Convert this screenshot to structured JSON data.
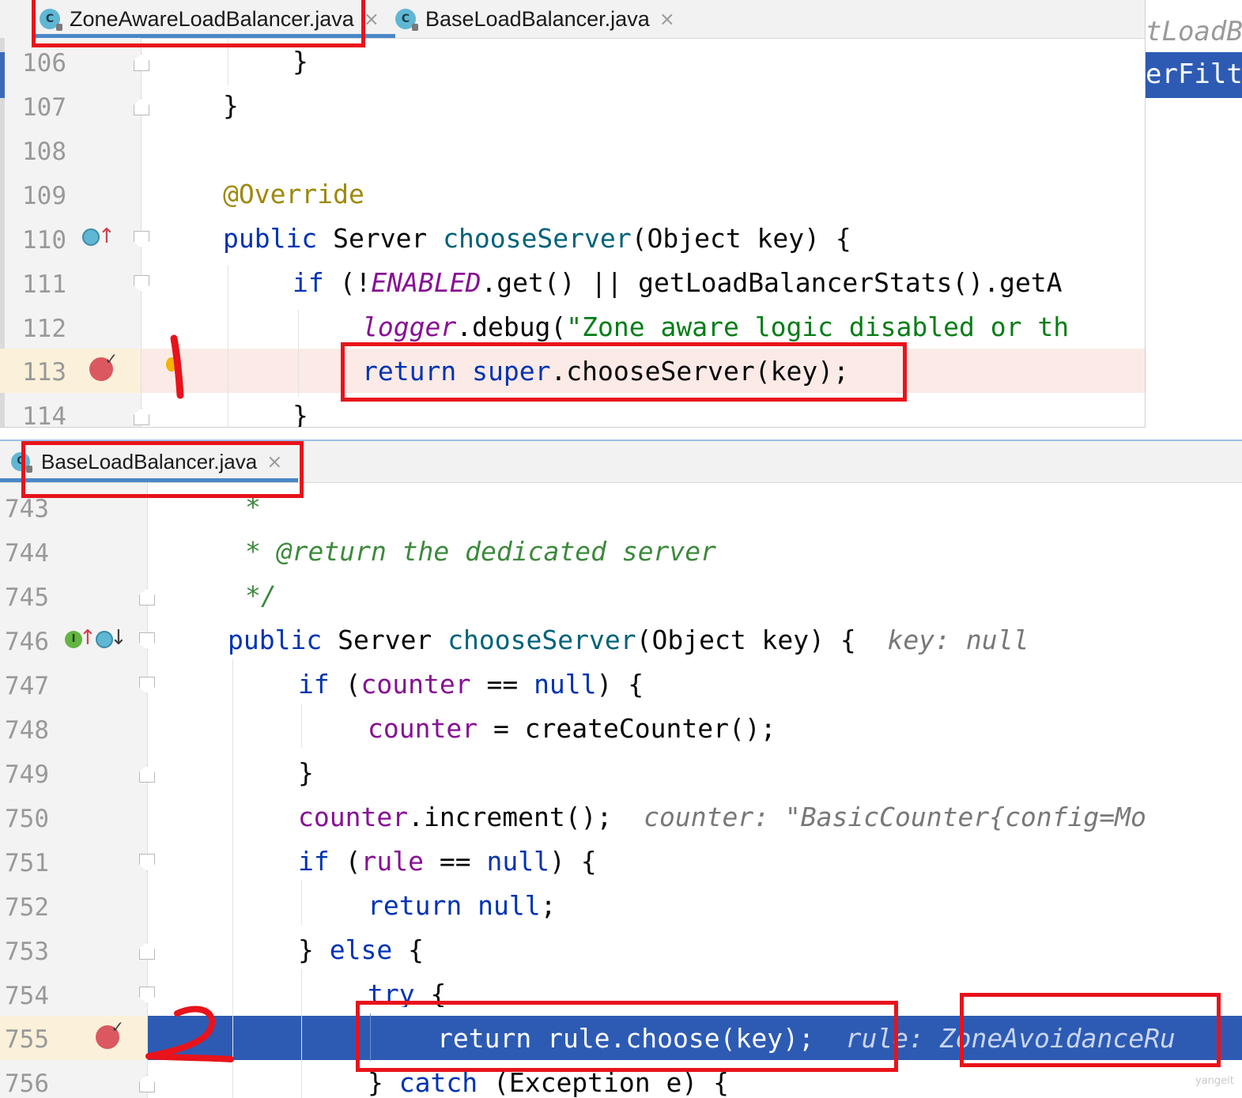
{
  "top_editor": {
    "tabs": [
      {
        "label": "ZoneAwareLoadBalancer.java",
        "close": "×",
        "active": true
      },
      {
        "label": "BaseLoadBalancer.java",
        "close": "×",
        "active": false
      }
    ],
    "right_peek": [
      "tLoadB",
      "erFilt"
    ],
    "lines": [
      {
        "num": "106"
      },
      {
        "num": "107"
      },
      {
        "num": "108"
      },
      {
        "num": "109"
      },
      {
        "num": "110"
      },
      {
        "num": "111"
      },
      {
        "num": "112"
      },
      {
        "num": "113"
      },
      {
        "num": "114"
      }
    ],
    "code": {
      "l106": "}",
      "l107": "}",
      "l109_annotation": "@Override",
      "l110_public": "public",
      "l110_type": "Server",
      "l110_method": "chooseServer",
      "l110_params": "(Object key) {",
      "l111_if": "if",
      "l111_open": " (!",
      "l111_enabled": "ENABLED",
      "l111_rest": ".get() || getLoadBalancerStats().getA",
      "l112_logger": "logger",
      "l112_debug": ".debug(",
      "l112_str": "\"Zone aware logic disabled or th",
      "l113_return": "return",
      "l113_super": "super",
      "l113_call": ".chooseServer(key);",
      "l114": "}"
    }
  },
  "bottom_editor": {
    "tabs": [
      {
        "label": "BaseLoadBalancer.java",
        "close": "×",
        "active": true
      }
    ],
    "lines": [
      {
        "num": "743"
      },
      {
        "num": "744"
      },
      {
        "num": "745"
      },
      {
        "num": "746"
      },
      {
        "num": "747"
      },
      {
        "num": "748"
      },
      {
        "num": "749"
      },
      {
        "num": "750"
      },
      {
        "num": "751"
      },
      {
        "num": "752"
      },
      {
        "num": "753"
      },
      {
        "num": "754"
      },
      {
        "num": "755"
      },
      {
        "num": "756"
      }
    ],
    "code": {
      "l743": "*",
      "l744": "* @return the dedicated server",
      "l745": "*/",
      "l746_public": "public",
      "l746_type": "Server",
      "l746_method": "chooseServer",
      "l746_params": "(Object key) {",
      "l746_hint": "key: null",
      "l747_if": "if",
      "l747_open": " (",
      "l747_counter": "counter",
      "l747_eq": " == ",
      "l747_null": "null",
      "l747_close": ") {",
      "l748_counter": "counter",
      "l748_rest": " = createCounter();",
      "l749": "}",
      "l750_counter": "counter",
      "l750_rest": ".increment();",
      "l750_hint": "counter: \"BasicCounter{config=Mo",
      "l751_if": "if",
      "l751_open": " (",
      "l751_rule": "rule",
      "l751_eq": " == ",
      "l751_null": "null",
      "l751_close": ") {",
      "l752_return": "return",
      "l752_null": "null",
      "l752_semi": ";",
      "l753_brace": "}",
      "l753_else": "else",
      "l753_open": "{",
      "l754_try": "try",
      "l754_open": "{",
      "l755_code": "return rule.choose(key);",
      "l755_hint": "rule: ZoneAvoidanceRu",
      "l756_brace": "}",
      "l756_catch": "catch",
      "l756_rest": "(Exception e) {"
    },
    "watermark": "yangeit"
  },
  "colors": {
    "keyword": "#0033b3",
    "method": "#00627a",
    "field": "#871094",
    "string": "#067d17",
    "annotation": "#9e880d",
    "doc_comment": "#3d8a3d",
    "exec_line": "#2d5bb4",
    "breakpoint_line": "#fbeae6",
    "breakpoint": "#db5860",
    "red_markup": "#e8131b"
  },
  "icons": [
    "class-icon",
    "close-icon",
    "breakpoint-icon",
    "override-icon",
    "implements-icon",
    "fold-marker-icon"
  ]
}
